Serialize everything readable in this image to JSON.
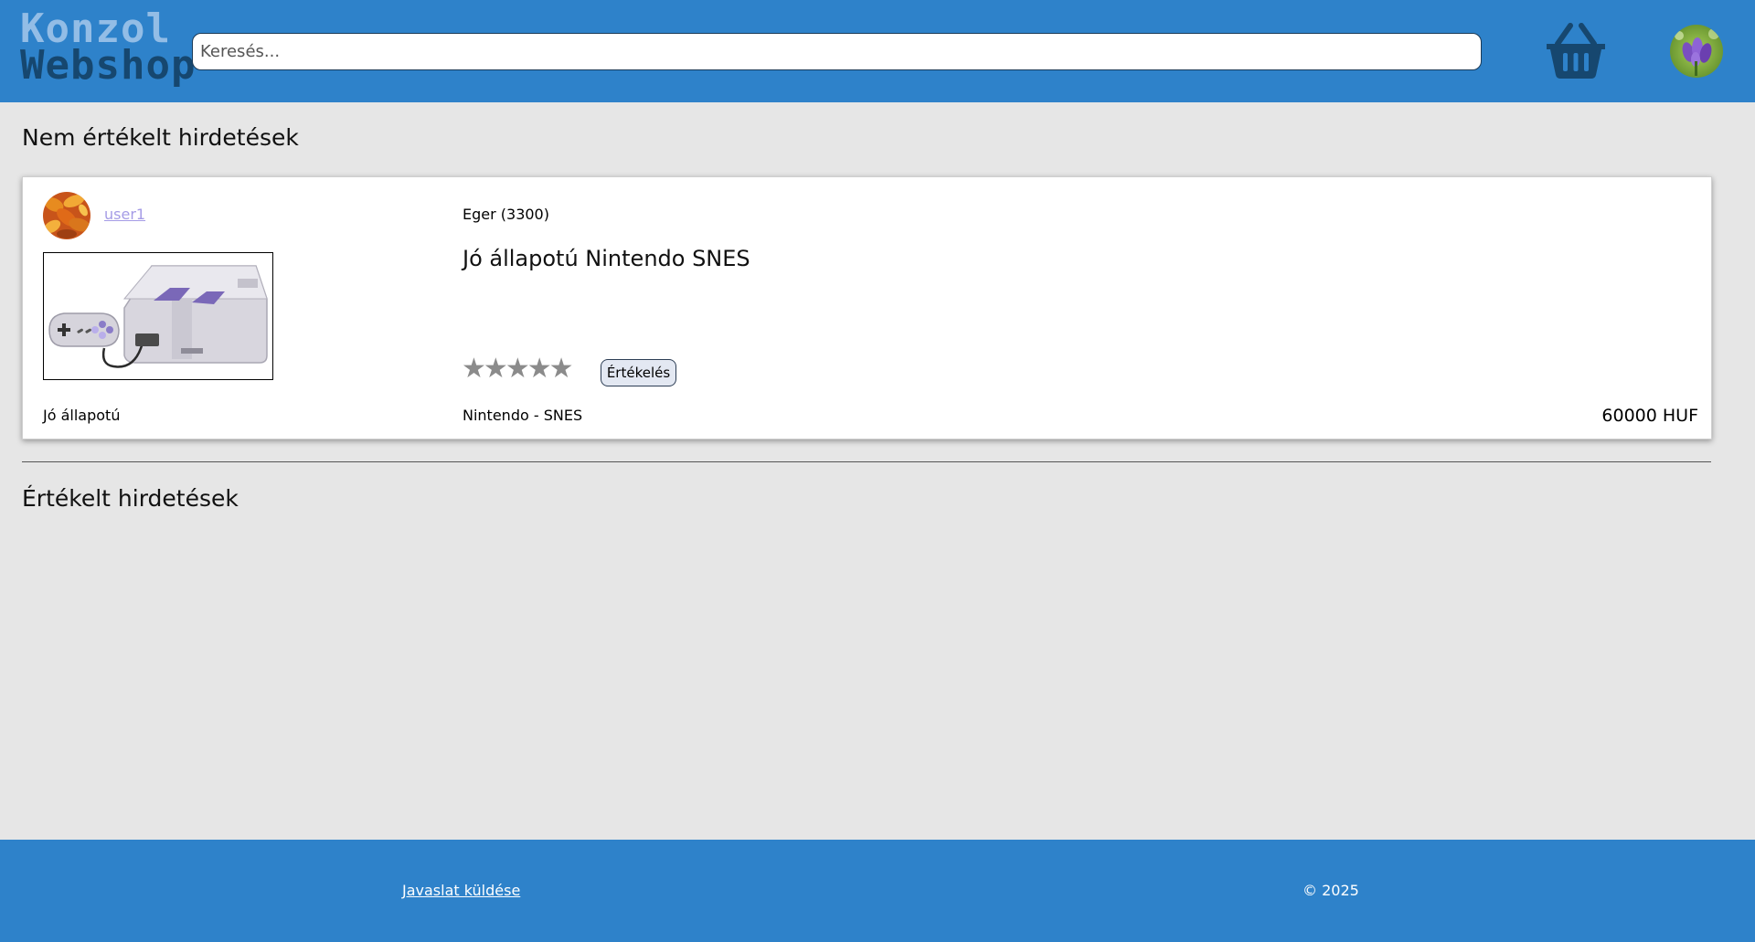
{
  "header": {
    "logo_line1": "Konzol",
    "logo_line2": "Webshop",
    "search_placeholder": "Keresés...",
    "cart_icon": "basket-icon",
    "avatar_icon": "crocus-flower-avatar"
  },
  "sections": {
    "unrated_title": "Nem értékelt hirdetések",
    "rated_title": "Értékelt hirdetések"
  },
  "listing": {
    "seller_name": "user1",
    "seller_avatar": "autumn-leaves-avatar",
    "location": "Eger (3300)",
    "title": "Jó állapotú Nintendo SNES",
    "image": "snes-console-photo",
    "rating": {
      "max": 5,
      "value": 0,
      "stars": [
        "★",
        "★",
        "★",
        "★",
        "★"
      ]
    },
    "rate_button": "Értékelés",
    "condition": "Jó állapotú",
    "category": "Nintendo - SNES",
    "price": "60000 HUF"
  },
  "footer": {
    "suggestion_link": "Javaslat küldése",
    "copyright": "© 2025"
  },
  "colors": {
    "header_bg": "#2e82ca",
    "page_bg": "#e6e6e6",
    "star_empty": "#8b8b8b",
    "user_link": "#a59ce6"
  }
}
